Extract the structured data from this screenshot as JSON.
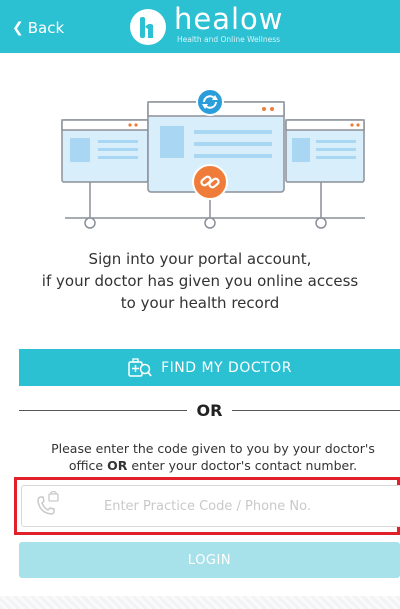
{
  "header": {
    "back_label": "Back",
    "logo_text": "healow",
    "logo_tagline": "Health and Online Wellness"
  },
  "intro": {
    "line1": "Sign into your portal account,",
    "line2": "if your doctor has given you online access",
    "line3": "to your health record"
  },
  "find_doctor": {
    "label": "FIND MY DOCTOR"
  },
  "divider": {
    "text": "OR"
  },
  "instructions": {
    "line1": "Please enter the code given to you by your doctor's",
    "line2_before": "office ",
    "line2_bold": "OR",
    "line2_after": " enter your doctor's contact number."
  },
  "code_input": {
    "placeholder": "Enter Practice Code / Phone No.",
    "value": ""
  },
  "login": {
    "label": "LOGIN"
  },
  "icons": {
    "back": "chevron-left-icon",
    "logo": "healow-logo-icon",
    "find_doctor": "doctor-search-icon",
    "phone": "phone-lock-icon",
    "sync": "sync-icon",
    "link": "link-icon"
  },
  "colors": {
    "brand": "#2cc0d3",
    "login_disabled": "#a7e1ea",
    "highlight": "#e0202a",
    "accent_orange": "#f07c3a",
    "sync_blue": "#2a9ddb"
  }
}
